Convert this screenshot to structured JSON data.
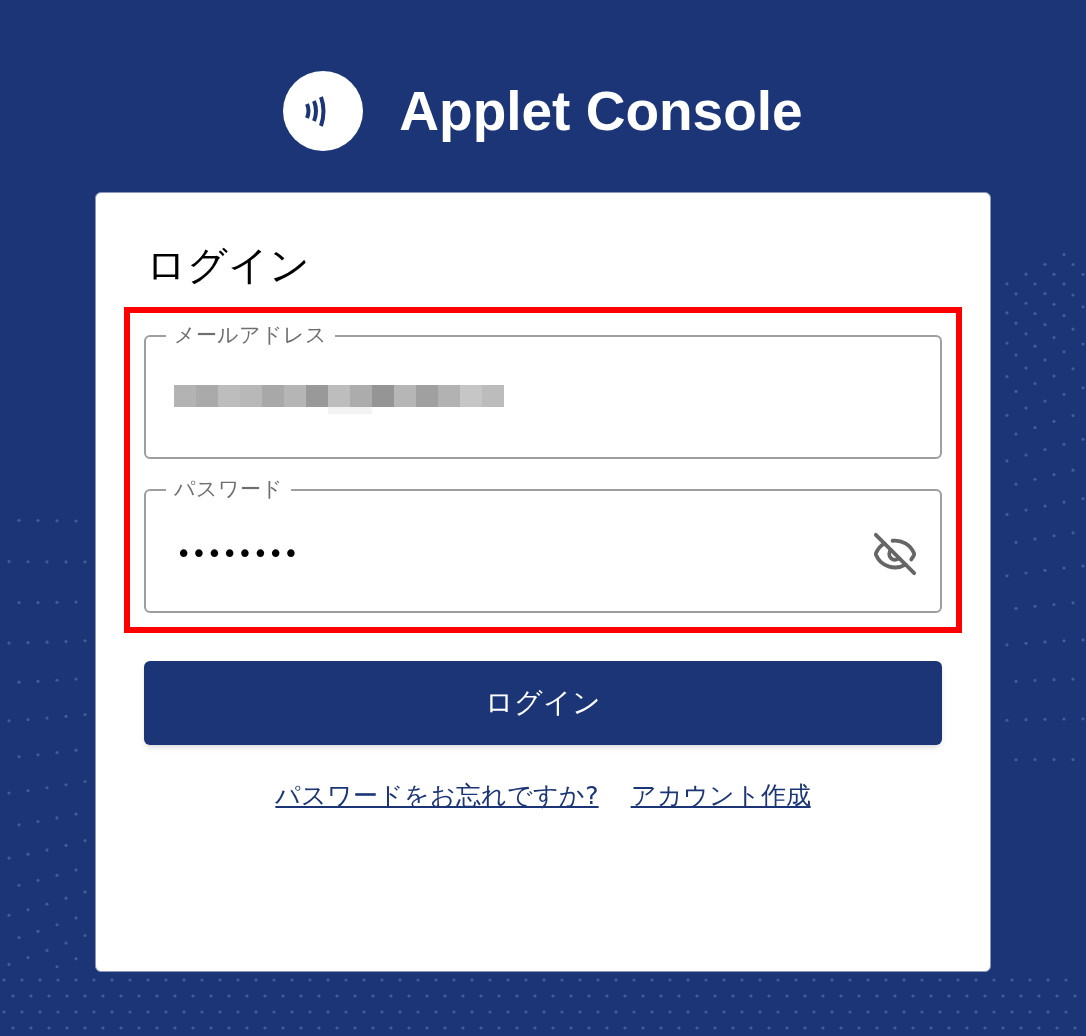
{
  "brand": {
    "name": "Applet Console"
  },
  "login_card": {
    "title": "ログイン",
    "highlight": true,
    "email_field": {
      "label": "メールアドレス"
    },
    "password_field": {
      "label": "パスワード",
      "value": "••••••••",
      "visible": false
    },
    "submit_button": "ログイン",
    "links": [
      {
        "label": "パスワードをお忘れですか?"
      },
      {
        "label": "アカウント作成"
      }
    ]
  }
}
